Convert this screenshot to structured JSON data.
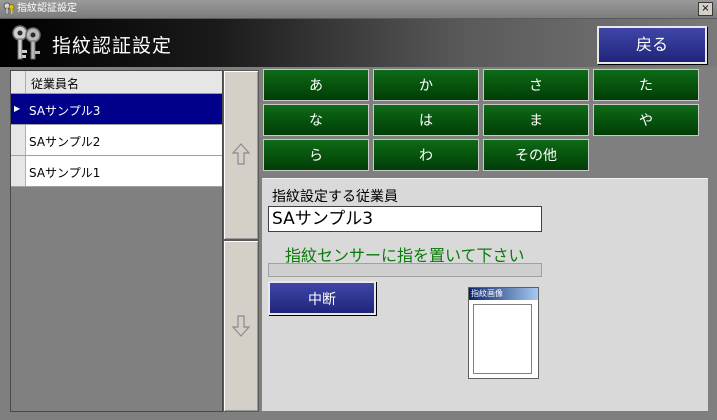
{
  "window": {
    "title": "指紋認証設定",
    "close_label": "×"
  },
  "header": {
    "title": "指紋認証設定",
    "back_label": "戻る"
  },
  "employee_list": {
    "column_header": "従業員名",
    "rows": [
      {
        "name": "SAサンプル3",
        "selected": true
      },
      {
        "name": "SAサンプル2",
        "selected": false
      },
      {
        "name": "SAサンプル1",
        "selected": false
      }
    ]
  },
  "kana_buttons": [
    "あ",
    "か",
    "さ",
    "た",
    "な",
    "は",
    "ま",
    "や",
    "ら",
    "わ",
    "その他"
  ],
  "form": {
    "employee_label": "指紋設定する従業員",
    "employee_value": "SAサンプル3",
    "instruction": "指紋センサーに指を置いて下さい",
    "progress": 0,
    "stop_label": "中断",
    "image_title": "指紋画像"
  },
  "colors": {
    "kana_bg": "#0b5d12",
    "button_bg": "#2a2f8c",
    "selected_row": "#00008b",
    "instruction_text": "#0a7a0a"
  },
  "icons": {
    "app": "keys-icon",
    "scroll_up": "arrow-up-icon",
    "scroll_down": "arrow-down-icon"
  }
}
